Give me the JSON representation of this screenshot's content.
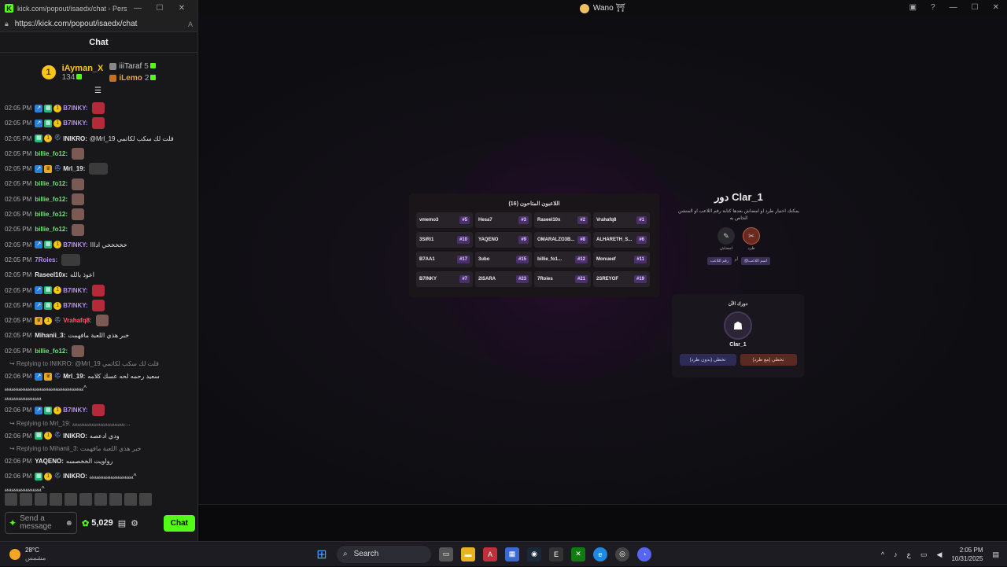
{
  "popout": {
    "title": "kick.com/popout/isaedx/chat - Person...",
    "url": "https://kick.com/popout/isaedx/chat",
    "reader_label": "A",
    "header": "Chat"
  },
  "leaderboard": {
    "rank": "1",
    "first_name": "iAyman_X",
    "first_count": "134",
    "second_name": "iiiTaraf",
    "second_count": "5",
    "third_name": "iLemo",
    "third_count": "2"
  },
  "messages": [
    {
      "ts": "02:05 PM",
      "badges": [
        "arr",
        "grid",
        "sub"
      ],
      "user": "B7INKY:",
      "cls": "purple",
      "text": "",
      "emote": "red"
    },
    {
      "ts": "02:05 PM",
      "badges": [
        "arr",
        "grid",
        "sub"
      ],
      "user": "B7INKY:",
      "cls": "purple",
      "text": "",
      "emote": "red"
    },
    {
      "ts": "02:05 PM",
      "badges": [
        "grid",
        "sub",
        "hat"
      ],
      "user": "INIKRO:",
      "cls": "white",
      "text": "@Mrl_19 قلت لك سكب لكاتمي",
      "emote": ""
    },
    {
      "ts": "02:05 PM",
      "badges": [],
      "user": "billie_fo12:",
      "cls": "green",
      "text": "",
      "emote": "cat"
    },
    {
      "ts": "02:05 PM",
      "badges": [
        "arr",
        "crown",
        "hat"
      ],
      "user": "Mrl_19:",
      "cls": "white",
      "text": "",
      "emote": "man"
    },
    {
      "ts": "02:05 PM",
      "badges": [],
      "user": "billie_fo12:",
      "cls": "green",
      "text": "",
      "emote": "cat"
    },
    {
      "ts": "02:05 PM",
      "badges": [],
      "user": "billie_fo12:",
      "cls": "green",
      "text": "",
      "emote": "cat"
    },
    {
      "ts": "02:05 PM",
      "badges": [],
      "user": "billie_fo12:",
      "cls": "green",
      "text": "",
      "emote": "cat"
    },
    {
      "ts": "02:05 PM",
      "badges": [],
      "user": "billie_fo12:",
      "cls": "green",
      "text": "",
      "emote": "cat"
    },
    {
      "ts": "02:05 PM",
      "badges": [
        "arr",
        "grid",
        "sub"
      ],
      "user": "B7INKY:",
      "cls": "purple",
      "text": "خخخخخي ادااا",
      "emote": ""
    },
    {
      "ts": "02:05 PM",
      "badges": [],
      "user": "7Roies:",
      "cls": "purple",
      "text": "",
      "emote": "man"
    },
    {
      "ts": "02:05 PM",
      "badges": [],
      "user": "Raseel10x:",
      "cls": "white",
      "text": "اعوذ بالله",
      "emote": ""
    },
    {
      "ts": "02:05 PM",
      "badges": [
        "arr",
        "grid",
        "sub"
      ],
      "user": "B7INKY:",
      "cls": "purple",
      "text": "",
      "emote": "red"
    },
    {
      "ts": "02:05 PM",
      "badges": [
        "arr",
        "grid",
        "sub"
      ],
      "user": "B7INKY:",
      "cls": "purple",
      "text": "",
      "emote": "red"
    },
    {
      "ts": "02:05 PM",
      "badges": [
        "crown",
        "sub",
        "hat"
      ],
      "user": "Vrahafq8:",
      "cls": "red",
      "text": "",
      "emote": "cat"
    },
    {
      "ts": "02:05 PM",
      "badges": [],
      "user": "Mihanii_3:",
      "cls": "white",
      "text": "خبر هذي اللعبة مافهمت",
      "emote": ""
    },
    {
      "ts": "02:05 PM",
      "badges": [],
      "user": "billie_fo12:",
      "cls": "green",
      "text": "",
      "emote": "cat"
    }
  ],
  "replies": {
    "r1": "↪ Replying to INIKRO: @Mrl_19 قلت لك سكب لكاتمي",
    "m1_ts": "02:06 PM",
    "m1_user": "Mrl_19:",
    "m1_text": "سعيد رحمه لحه عسك كلامه",
    "spam1": "ﯾﯾﯾﯾﯾﯾﯾﯾﯾﯾﯾﯾﯾﯾﯾﯾﯾﯾﯾﯾﯾﯾﯾﯾﯾﯾﯾﯾﯾﯾﯾﯾﯾﯾﯾﯾﯾﯾﯾﯾﯾﯾﯾﯾﯾ^",
    "spam1b": "ﯾﯾﯾﯾﯾﯾﯾﯾﯾﯾﯾﯾﯾﯾﯾﯾﯾﯾﯾﯾﯾ",
    "m2_ts": "02:06 PM",
    "m2_user": "B7INKY:",
    "r2": "↪ Replying to Mrl_19: ﯾﯾﯾﯾﯾﯾﯾﯾﯾﯾﯾﯾﯾﯾﯾﯾﯾﯾﯾﯾﯾﯾﯾﯾﯾﯾﯾﯾﯾﯾ...",
    "m3_ts": "02:06 PM",
    "m3_user": "INIKRO:",
    "m3_text": "ودي ادعصه",
    "r3": "↪ Replying to Mihanii_3: خبر هذي اللعبة مافهمت",
    "m4_ts": "02:06 PM",
    "m4_user": "YAQENO:",
    "m4_text": "رواويت الخخصسه",
    "m5_ts": "02:06 PM",
    "m5_user": "INIKRO:",
    "m5_text": "ﯾﯾﯾﯾﯾﯾﯾﯾﯾﯾﯾﯾﯾﯾﯾﯾﯾﯾﯾﯾﯾﯾﯾﯾﯾ^",
    "spam2": "ﯾﯾﯾﯾﯾﯾﯾﯾﯾﯾﯾﯾﯾﯾﯾﯾﯾﯾﯾﯾﯾ^"
  },
  "chat_input": {
    "placeholder_line1": "Send a",
    "placeholder_line2": "message",
    "points": "5,029",
    "send_label": "Chat"
  },
  "game": {
    "window_title": "Wano ⛩",
    "players_title": "اللاعبون المتاحون (16)",
    "players": [
      {
        "name": "vmemo3",
        "num": "#5"
      },
      {
        "name": "Hesa7",
        "num": "#3"
      },
      {
        "name": "Raseel10x",
        "num": "#2"
      },
      {
        "name": "Vrahafq8",
        "num": "#1"
      },
      {
        "name": "3SiRi1",
        "num": "#10"
      },
      {
        "name": "YAQENO",
        "num": "#9"
      },
      {
        "name": "OMARALZO3B...",
        "num": "#8"
      },
      {
        "name": "ALHARETH_S...",
        "num": "#6"
      },
      {
        "name": "B7AA1",
        "num": "#17"
      },
      {
        "name": "3ubo",
        "num": "#15"
      },
      {
        "name": "billie_fo1...",
        "num": "#12"
      },
      {
        "name": "Monueef",
        "num": "#11"
      },
      {
        "name": "B7INKY",
        "num": "#7"
      },
      {
        "name": "2ISARA",
        "num": "#23"
      },
      {
        "name": "7Roies",
        "num": "#21"
      },
      {
        "name": "2SREYOF",
        "num": "#19"
      }
    ],
    "turn_title": "دور Clar_1",
    "turn_desc": "يمكنك اختيار طرد او امضاش بعدها كتابة رقم اللاعب او المنشن الخاص به",
    "icon1_label": "امضاش",
    "icon2_label": "طرد",
    "tag1": "رقم اللاعب",
    "tag_or": "أو",
    "tag2": "@اسم اللاعب",
    "current_label": "دورك الآن",
    "current_name": "Clar_1",
    "skip_no": "تخطي (بدون طرد)",
    "skip_yes": "تخطي (مع طرد)"
  },
  "taskbar": {
    "temp": "28°C",
    "condition": "مشمس",
    "search": "Search",
    "time": "2:05 PM",
    "date": "10/31/2025",
    "lang": "ع"
  }
}
